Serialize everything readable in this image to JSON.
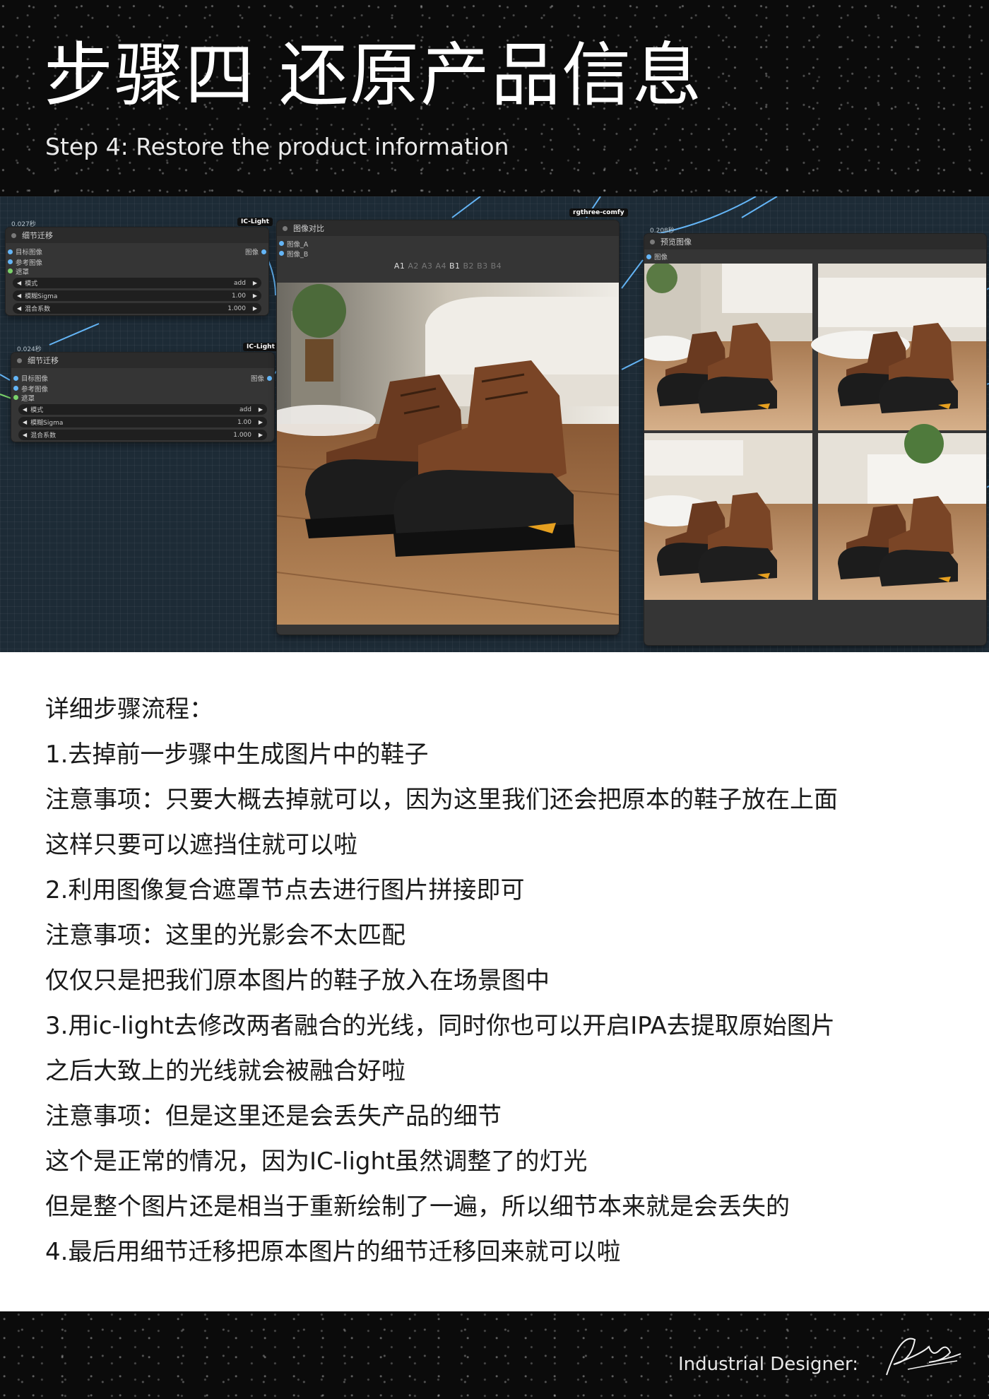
{
  "header": {
    "title": "步骤四 还原产品信息",
    "subtitle": "Step 4: Restore the product information"
  },
  "workflow": {
    "node_transfer_1": {
      "timing": "0.027秒",
      "badge": "IC-Light",
      "title": "细节迁移",
      "inputs": [
        "目标图像",
        "参考图像",
        "遮罩"
      ],
      "output": "图像",
      "widgets": [
        {
          "label": "模式",
          "value": "add"
        },
        {
          "label": "模糊Sigma",
          "value": "1.00"
        },
        {
          "label": "混合系数",
          "value": "1.000"
        }
      ]
    },
    "node_transfer_2": {
      "timing": "0.024秒",
      "badge": "IC-Light",
      "title": "细节迁移",
      "inputs": [
        "目标图像",
        "参考图像",
        "遮罩"
      ],
      "output": "图像",
      "widgets": [
        {
          "label": "模式",
          "value": "add"
        },
        {
          "label": "模糊Sigma",
          "value": "1.00"
        },
        {
          "label": "混合系数",
          "value": "1.000"
        }
      ]
    },
    "node_compare": {
      "badge": "rgthree-comfy",
      "title": "图像对比",
      "inputs": [
        "图像_A",
        "图像_B"
      ],
      "tabs": [
        "A1",
        "A2",
        "A3",
        "A4",
        "B1",
        "B2",
        "B3",
        "B4"
      ],
      "active_tabs": [
        "A1",
        "B1"
      ]
    },
    "node_preview": {
      "timing": "0.208秒",
      "title": "预览图像",
      "input": "图像"
    }
  },
  "content": {
    "lines": [
      "详细步骤流程：",
      "1.去掉前一步骤中生成图片中的鞋子",
      "注意事项：只要大概去掉就可以，因为这里我们还会把原本的鞋子放在上面",
      "这样只要可以遮挡住就可以啦",
      "2.利用图像复合遮罩节点去进行图片拼接即可",
      "注意事项：这里的光影会不太匹配",
      "仅仅只是把我们原本图片的鞋子放入在场景图中",
      "3.用ic-light去修改两者融合的光线，同时你也可以开启IPA去提取原始图片",
      "之后大致上的光线就会被融合好啦",
      "注意事项：但是这里还是会丢失产品的细节",
      "这个是正常的情况，因为IC-light虽然调整了的灯光",
      "但是整个图片还是相当于重新绘制了一遍，所以细节本来就是会丢失的",
      "4.最后用细节迁移把原本图片的细节迁移回来就可以啦"
    ]
  },
  "footer": {
    "designer_label": "Industrial Designer:"
  },
  "colors": {
    "header_bg": "#0b0b0b",
    "canvas_bg": "#1d2b36",
    "node_bg": "#353535",
    "wire_blue": "#64b5f6",
    "wire_green": "#7bd36b"
  }
}
